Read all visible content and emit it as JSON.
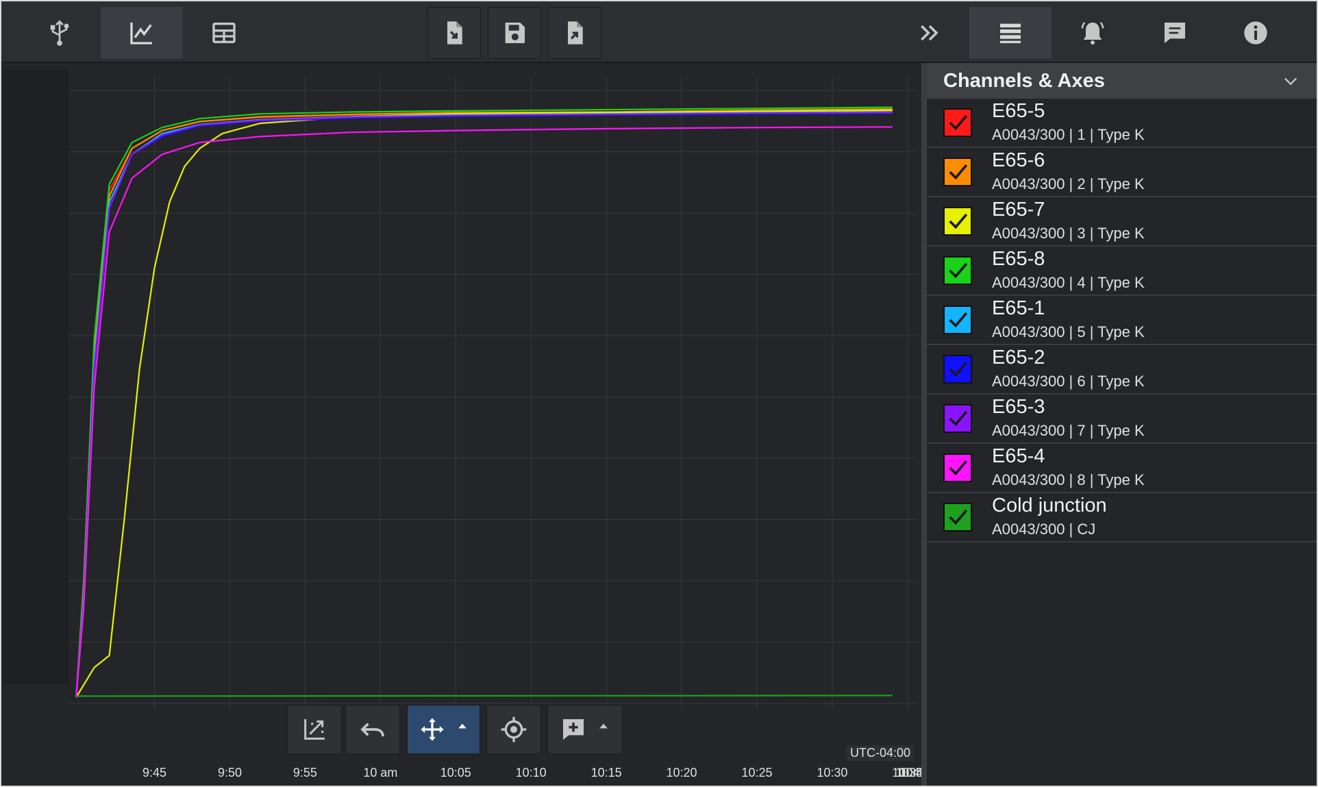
{
  "toolbar": {
    "left_icons": [
      "usb-icon",
      "chart-line-icon",
      "table-icon"
    ],
    "file_icons": [
      "file-import-icon",
      "save-icon",
      "file-export-icon"
    ],
    "right_icons": [
      "double-chevron-right-icon",
      "list-icon",
      "bell-icon",
      "comment-icon",
      "info-icon"
    ]
  },
  "sidebar": {
    "title": "Channels & Axes",
    "channels": [
      {
        "name": "E65-5",
        "sub": "A0043/300 | 1 | Type K",
        "color": "#ff1a1a",
        "checked": true
      },
      {
        "name": "E65-6",
        "sub": "A0043/300 | 2 | Type K",
        "color": "#ff8c00",
        "checked": true
      },
      {
        "name": "E65-7",
        "sub": "A0043/300 | 3 | Type K",
        "color": "#e6f000",
        "checked": true
      },
      {
        "name": "E65-8",
        "sub": "A0043/300 | 4 | Type K",
        "color": "#19d219",
        "checked": true
      },
      {
        "name": "E65-1",
        "sub": "A0043/300 | 5 | Type K",
        "color": "#14b4ff",
        "checked": true
      },
      {
        "name": "E65-2",
        "sub": "A0043/300 | 6 | Type K",
        "color": "#1010ff",
        "checked": true
      },
      {
        "name": "E65-3",
        "sub": "A0043/300 | 7 | Type K",
        "color": "#8a14ff",
        "checked": true
      },
      {
        "name": "E65-4",
        "sub": "A0043/300 | 8 | Type K",
        "color": "#ff14ff",
        "checked": true
      },
      {
        "name": "Cold junction",
        "sub": "A0043/300 | CJ",
        "color": "#1fa01f",
        "checked": true
      }
    ]
  },
  "plot_toolbar": {
    "icons": [
      "autoscale-icon",
      "undo-icon",
      "pan-icon",
      "crosshair-icon",
      "add-comment-icon"
    ],
    "active": "pan-icon"
  },
  "timezone": "UTC-04:00",
  "chart_data": {
    "type": "line",
    "x_ticks": [
      "9:45",
      "9:50",
      "9:55",
      "10 am",
      "10:05",
      "10:10",
      "10:15",
      "10:20",
      "10:25",
      "10:30",
      "10:35",
      "10:40",
      "10:4"
    ],
    "x_range_minutes": [
      9.38,
      65.6
    ],
    "y_range": [
      0,
      100
    ],
    "y_tick_labels_visible": false,
    "grid": true,
    "series": [
      {
        "name": "E65-5",
        "color": "#ff1a1a",
        "x": [
          9.8,
          10.3,
          11.0,
          12.0,
          13.5,
          15.5,
          18,
          22,
          28,
          35,
          45,
          55,
          64
        ],
        "y": [
          0,
          20,
          60,
          85,
          92,
          95,
          96.5,
          97.2,
          97.6,
          97.9,
          98.0,
          98.2,
          98.3
        ]
      },
      {
        "name": "E65-6",
        "color": "#ff8c00",
        "x": [
          9.8,
          10.3,
          11.0,
          12.0,
          13.5,
          15.5,
          18,
          22,
          28,
          35,
          45,
          55,
          64
        ],
        "y": [
          0,
          18,
          58,
          84,
          92,
          95,
          96.5,
          97.3,
          97.7,
          98.0,
          98.1,
          98.4,
          98.6
        ]
      },
      {
        "name": "E65-7",
        "color": "#e6f000",
        "x": [
          9.8,
          11.0,
          12.0,
          13.0,
          14.0,
          15.0,
          16.0,
          17.0,
          18.0,
          19.5,
          22,
          28,
          35,
          45,
          55,
          64
        ],
        "y": [
          0,
          5,
          7,
          30,
          55,
          72,
          83,
          89,
          92,
          94.5,
          96.2,
          97.3,
          97.8,
          98.0,
          98.2,
          98.4
        ]
      },
      {
        "name": "E65-8",
        "color": "#19d219",
        "x": [
          9.8,
          10.3,
          11.0,
          12.0,
          13.5,
          15.5,
          18,
          22,
          28,
          35,
          45,
          55,
          64
        ],
        "y": [
          0,
          19,
          60,
          86,
          93,
          95.5,
          97,
          97.8,
          98.1,
          98.3,
          98.5,
          98.7,
          98.9
        ]
      },
      {
        "name": "E65-1",
        "color": "#14b4ff",
        "x": [
          9.8,
          10.3,
          11.0,
          12.0,
          13.5,
          15.5,
          18,
          22,
          28,
          35,
          45,
          55,
          64
        ],
        "y": [
          0,
          17,
          56,
          83,
          91,
          94.5,
          96,
          96.8,
          97.3,
          97.6,
          97.8,
          98.0,
          98.1
        ]
      },
      {
        "name": "E65-2",
        "color": "#1010ff",
        "x": [
          9.8,
          10.3,
          11.0,
          12.0,
          13.5,
          15.5,
          18,
          22,
          28,
          35,
          45,
          55,
          64
        ],
        "y": [
          0,
          16,
          55,
          82,
          91,
          94,
          95.8,
          96.6,
          97.1,
          97.4,
          97.6,
          97.8,
          97.9
        ]
      },
      {
        "name": "E65-3",
        "color": "#8a14ff",
        "x": [
          9.8,
          10.3,
          11.0,
          12.0,
          13.5,
          15.5,
          18,
          22,
          28,
          35,
          45,
          55,
          64
        ],
        "y": [
          0,
          16,
          55,
          82,
          91,
          94.2,
          95.9,
          96.7,
          97.2,
          97.5,
          97.7,
          97.9,
          98.0
        ]
      },
      {
        "name": "E65-4",
        "color": "#ff14ff",
        "x": [
          9.8,
          10.3,
          11.0,
          12.0,
          13.5,
          15.5,
          18,
          22,
          28,
          35,
          45,
          55,
          64
        ],
        "y": [
          0,
          15,
          52,
          78,
          87,
          91,
          93,
          94,
          94.7,
          95.0,
          95.3,
          95.5,
          95.6
        ]
      },
      {
        "name": "Cold junction",
        "color": "#1fa01f",
        "x": [
          9.8,
          64
        ],
        "y": [
          0.2,
          0.3
        ]
      }
    ]
  }
}
